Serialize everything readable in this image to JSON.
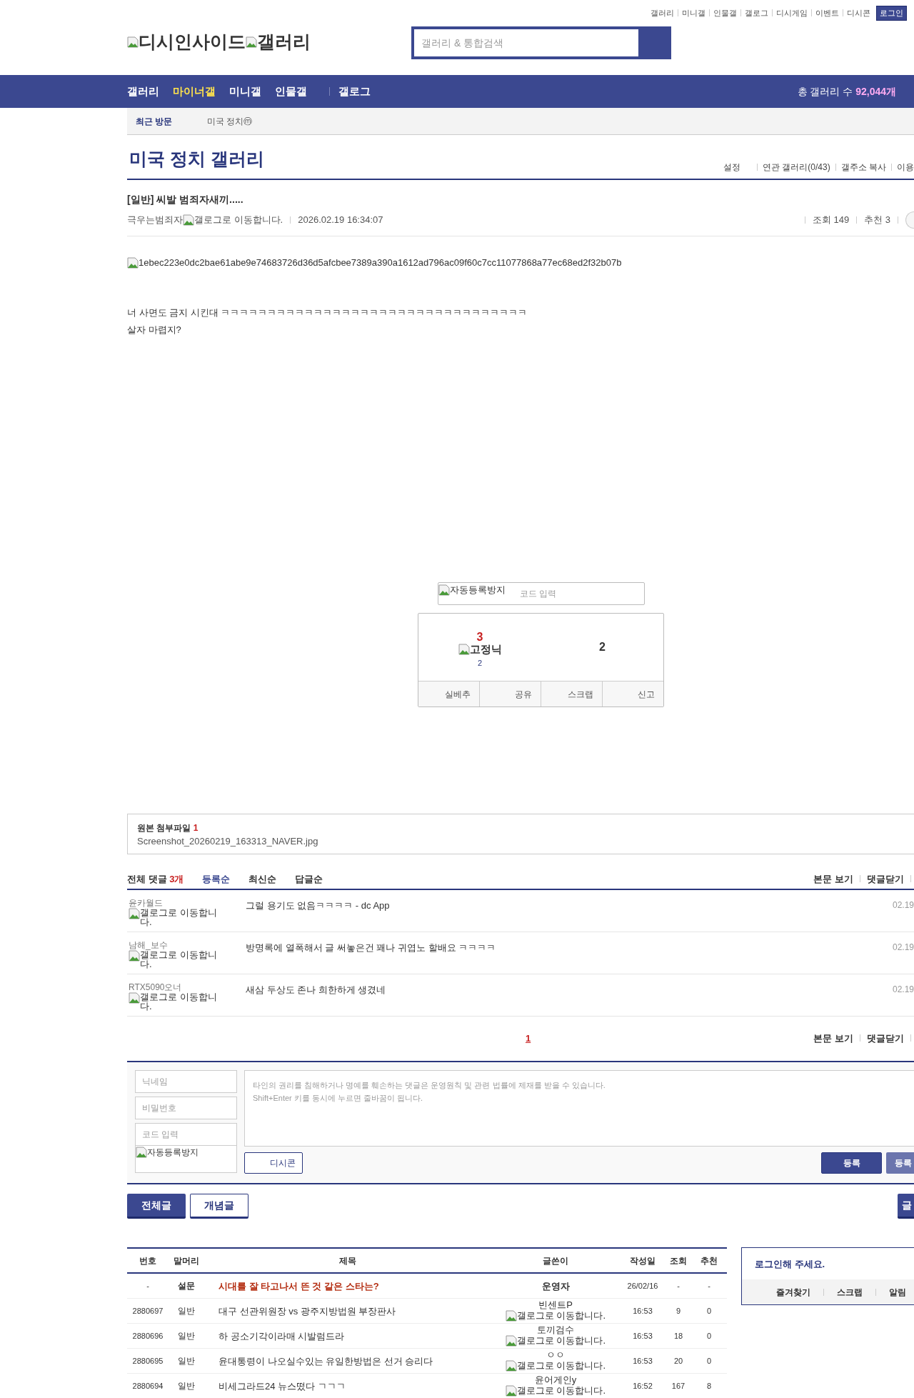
{
  "top_links": [
    "갤러리",
    "미니갤",
    "인물갤",
    "갤로그",
    "디시게임",
    "이벤트",
    "디시콘"
  ],
  "login_button": "로그인",
  "logo_alts": [
    "디시인사이드",
    "갤러리"
  ],
  "search": {
    "placeholder": "갤러리 & 통합검색"
  },
  "nav": [
    {
      "label": "갤러리",
      "selected": false
    },
    {
      "label": "마이너갤",
      "selected": true
    },
    {
      "label": "미니갤",
      "selected": false
    },
    {
      "label": "인물갤",
      "selected": false
    },
    {
      "label": "갤로그",
      "selected": false
    }
  ],
  "gallery_count": {
    "label": "총 갤러리 수",
    "value": "92,044개"
  },
  "recent": {
    "label": "최근 방문",
    "items": [
      "미국 정치ⓜ"
    ]
  },
  "gallery_title": "미국 정치 갤러리",
  "gallery_links": [
    "설정",
    "연관 갤러리(0/43)",
    "갤주소 복사",
    "이용"
  ],
  "post": {
    "title": "[일반] 씨발 범죄자새끼.....",
    "author": "극우는범죄자",
    "author_icon_alt": "갤로그로 이동합니다.",
    "date": "2026.02.19 16:34:07",
    "views": "조회 149",
    "recommends": "추천 3",
    "image_alt": "1ebec223e0dc2bae61abe9e74683726d36d5afcbee7389a390a1612ad796ac09f60c7cc11077868a77ec68ed2f32b07b",
    "body": [
      "너 사면도 금지 시킨대 ㅋㅋㅋㅋㅋㅋㅋㅋㅋㅋㅋㅋㅋㅋㅋㅋㅋㅋㅋㅋㅋㅋㅋㅋㅋㅋㅋㅋㅋㅋㅋㅋㅋ",
      "살자 마렵지?"
    ]
  },
  "captcha": {
    "image_alt": "자동등록방지",
    "placeholder": "코드 입력"
  },
  "vote": {
    "up": "3",
    "fixed_alt": "고정닉",
    "fixed_count": "2",
    "down": "2",
    "buttons": [
      "실베추",
      "공유",
      "스크랩",
      "신고"
    ]
  },
  "attachment": {
    "label": "원본 첨부파일",
    "count": "1",
    "file": "Screenshot_20260219_163313_NAVER.jpg"
  },
  "comments_header": {
    "label": "전체 댓글",
    "count": "3개",
    "sorts": [
      {
        "label": "등록순",
        "selected": true
      },
      {
        "label": "최신순",
        "selected": false
      },
      {
        "label": "답글순",
        "selected": false
      }
    ],
    "links": [
      "본문 보기",
      "댓글닫기"
    ]
  },
  "comments": [
    {
      "author": "윤카월드",
      "icon_alt": "갤로그로 이동합니다.",
      "text": "그럴 용기도 없음ㅋㅋㅋㅋ - dc App",
      "date": "02.19"
    },
    {
      "author": "남해_보수",
      "icon_alt": "갤로그로 이동합니다.",
      "text": "방명록에 열폭해서 글 써놓은건 꽤나 귀엽노 할배요 ㅋㅋㅋㅋ",
      "date": "02.19"
    },
    {
      "author": "RTX5090오너",
      "icon_alt": "갤로그로 이동합니다.",
      "text": "새삼 두상도 존나 희한하게 생겼네",
      "date": "02.19"
    }
  ],
  "pagination": [
    {
      "label": "1",
      "selected": true
    }
  ],
  "bottom_links": [
    "본문 보기",
    "댓글닫기"
  ],
  "comment_form": {
    "nickname": {
      "placeholder": "닉네임"
    },
    "password": {
      "placeholder": "비밀번호"
    },
    "code": {
      "placeholder": "코드 입력"
    },
    "captcha_alt": "자동등록방지",
    "textarea": {
      "placeholder": "타인의 권리를 침해하거나 명예를 훼손하는 댓글은 운영원칙 및 관련 법률에 제재를 받을 수 있습니다.\nShift+Enter 키를 동시에 누르면 줄바꿈이 됩니다."
    },
    "dccon": "디시콘",
    "submit": "등록",
    "submit2": "등록"
  },
  "list_tabs": [
    {
      "label": "전체글",
      "selected": true
    },
    {
      "label": "개념글",
      "selected": false
    }
  ],
  "write_button": "글",
  "table": {
    "columns": [
      "번호",
      "말머리",
      "제목",
      "글쓴이",
      "작성일",
      "조회",
      "추천"
    ],
    "rows": [
      {
        "kind": "notice",
        "no": "-",
        "head": "설문",
        "title": "시대를 잘 타고나서 뜬 것 같은 스타는?",
        "writer": "운영자",
        "date": "26/02/16",
        "views": "-",
        "recs": "-"
      },
      {
        "kind": "post",
        "no": "2880697",
        "head": "일반",
        "title": "대구 선관위원장 vs 광주지방법원 부장판사",
        "writer": "빈센트P",
        "icon_alt": "갤로그로 이동합니다.",
        "date": "16:53",
        "views": "9",
        "recs": "0"
      },
      {
        "kind": "post",
        "no": "2880696",
        "head": "일반",
        "title": "하 공소기각이라매 시발럼드라",
        "writer": "토끼검수",
        "icon_alt": "갤로그로 이동합니다.",
        "date": "16:53",
        "views": "18",
        "recs": "0"
      },
      {
        "kind": "post",
        "no": "2880695",
        "head": "일반",
        "title": "윤대통령이 나오실수있는 유일한방법은 선거 승리다",
        "writer": "ㅇㅇ",
        "icon_alt": "갤로그로 이동합니다.",
        "date": "16:53",
        "views": "20",
        "recs": "0"
      },
      {
        "kind": "post",
        "no": "2880694",
        "head": "일반",
        "title": "비세그라드24 뉴스떴다 ㄱㄱㄱ",
        "writer": "윤어게인y",
        "icon_alt": "갤로그로 이동합니다.",
        "date": "16:52",
        "views": "167",
        "recs": "8"
      }
    ]
  },
  "login_box": {
    "title": "로그인해 주세요.",
    "links": [
      "즐겨찾기",
      "스크랩",
      "알림"
    ]
  }
}
